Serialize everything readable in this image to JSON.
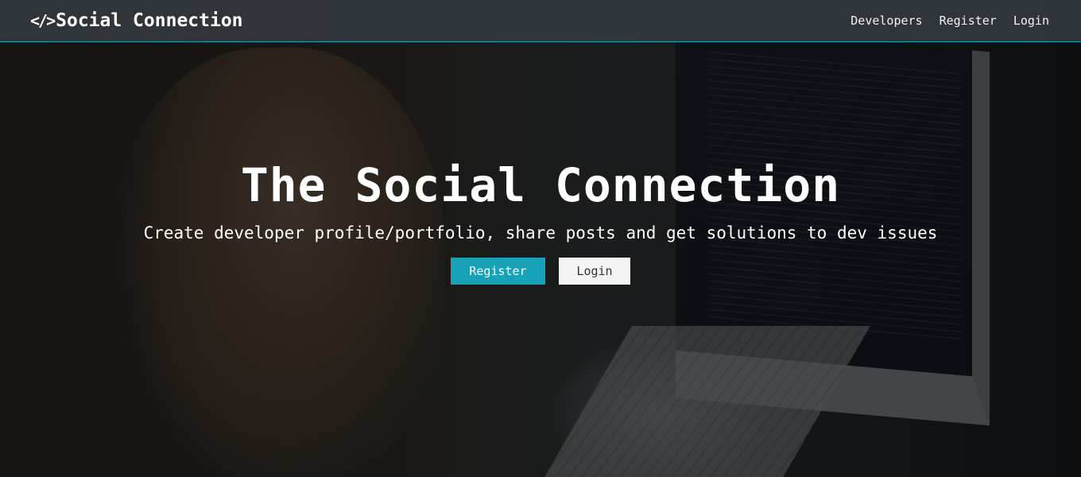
{
  "navbar": {
    "brand_icon": "</>",
    "brand_text": "Social Connection",
    "links": [
      {
        "label": "Developers"
      },
      {
        "label": "Register"
      },
      {
        "label": "Login"
      }
    ]
  },
  "hero": {
    "title": "The Social Connection",
    "lead": "Create developer profile/portfolio, share posts and get solutions to dev issues",
    "buttons": {
      "register": "Register",
      "login": "Login"
    }
  },
  "colors": {
    "accent": "#17a2b8",
    "navbar_bg": "#343a40",
    "button_light": "#f4f4f4"
  },
  "icons": {
    "brand": "code-icon"
  }
}
